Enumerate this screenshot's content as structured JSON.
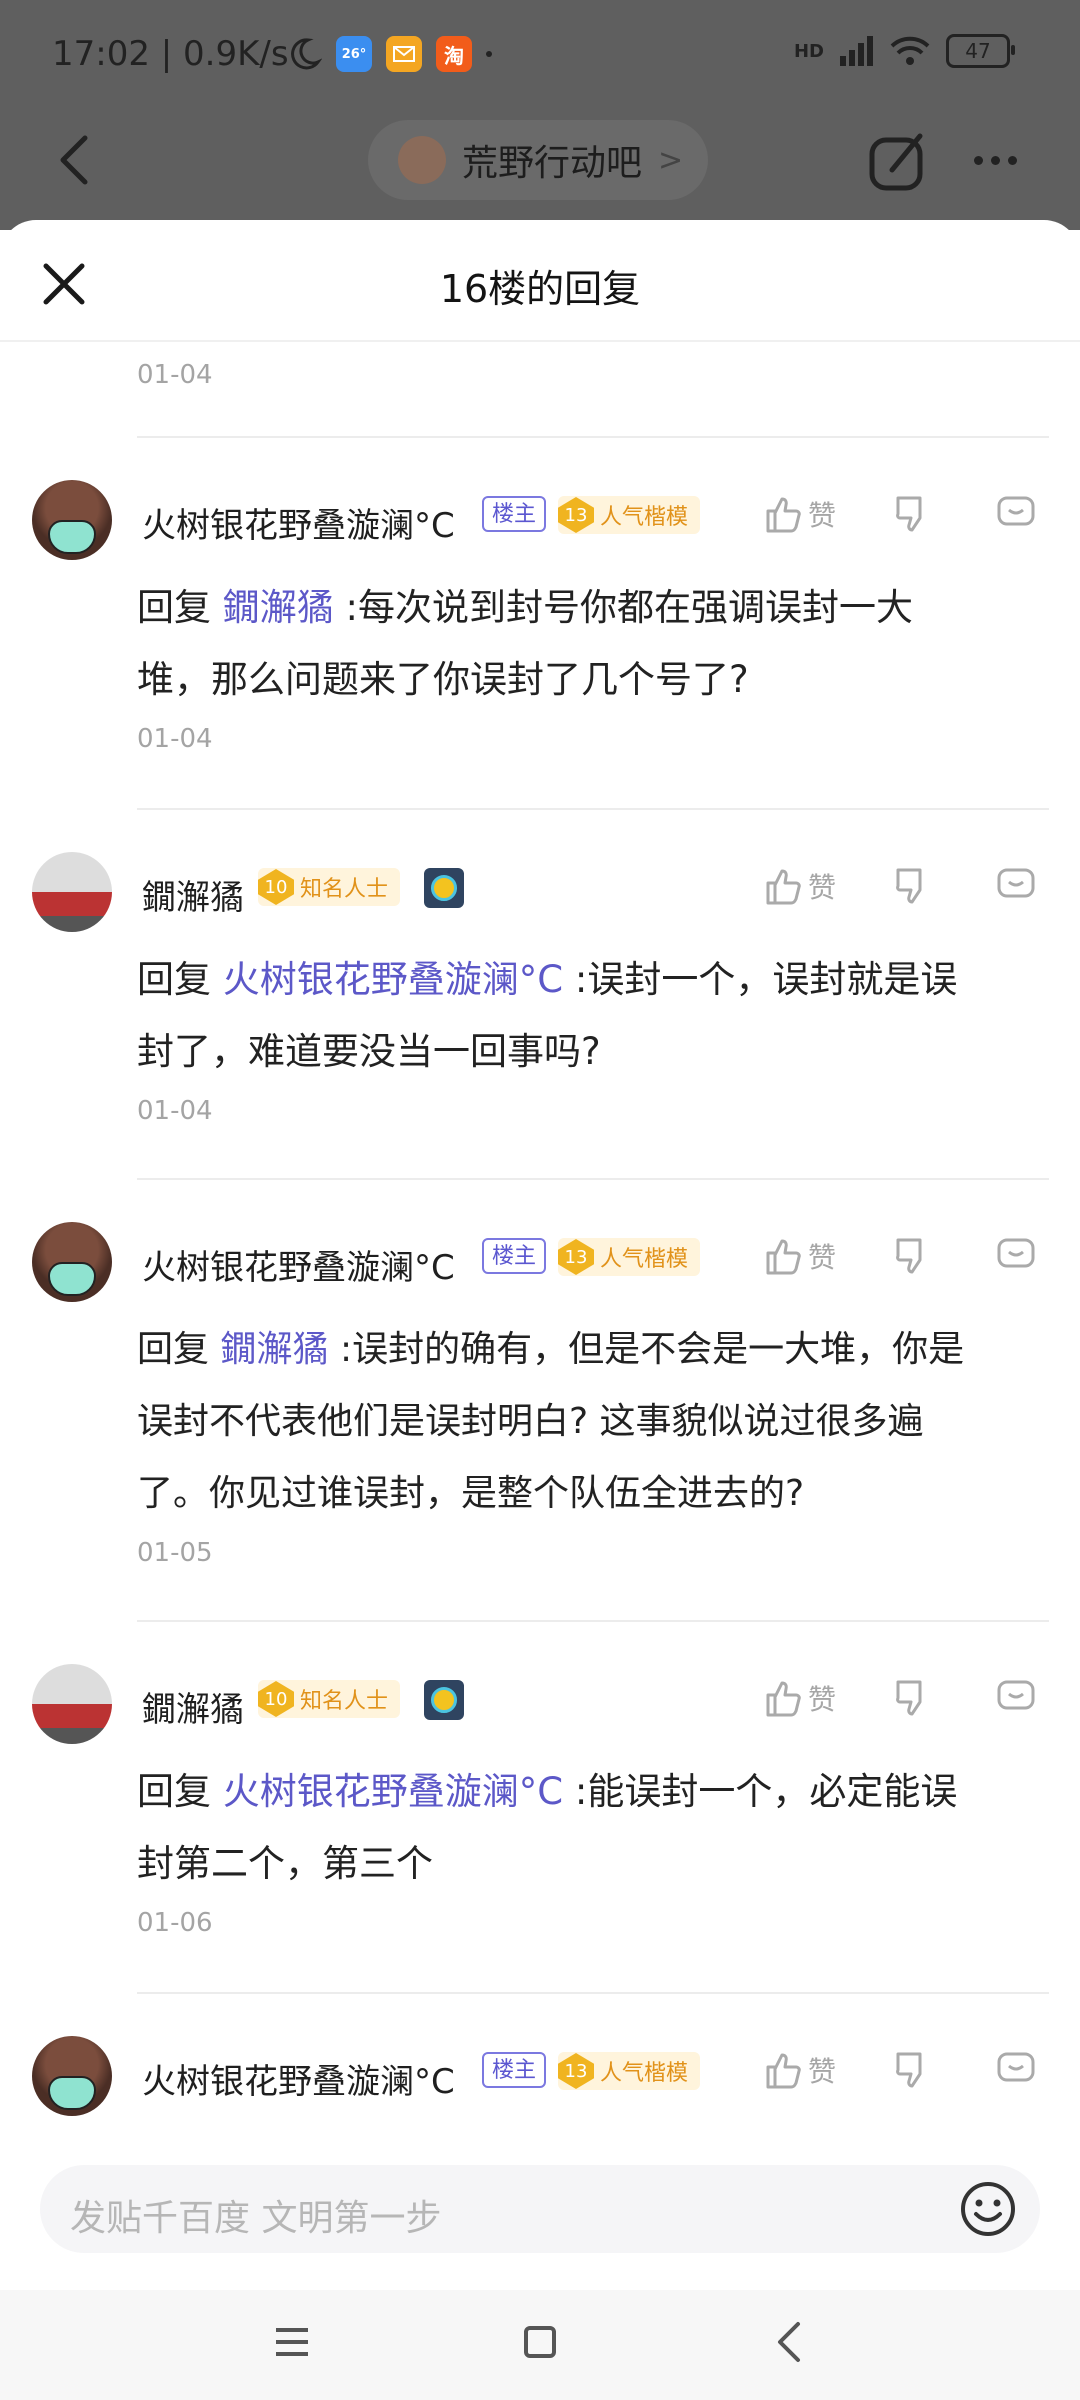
{
  "status_bar": {
    "time": "17:02 | 0.9K/s",
    "weather_badge": "26°",
    "taobao_badge": "淘",
    "network": "HD",
    "battery": "47"
  },
  "top_nav": {
    "forum_name": "荒野行动吧",
    "chevron": ">"
  },
  "sheet": {
    "title": "16楼的回复",
    "first_time": "01-04"
  },
  "actions": {
    "like_label": "赞"
  },
  "replies": [
    {
      "user": "火树银花野叠漩澜°C",
      "owner_tag": "楼主",
      "level": "13",
      "level_title": "人气楷模",
      "reply_prefix": "回复",
      "mention": "鐗澥獝",
      "text_line1": ":每次说到封号你都在强调误封一大",
      "text_line2": "堆，那么问题来了你误封了几个号了?",
      "time": "01-04"
    },
    {
      "user": "鐗澥獝",
      "level": "10",
      "level_title": "知名人士",
      "reply_prefix": "回复",
      "mention": "火树银花野叠漩澜°C",
      "text_line1": ":误封一个，误封就是误",
      "text_line2": "封了，难道要没当一回事吗?",
      "time": "01-04"
    },
    {
      "user": "火树银花野叠漩澜°C",
      "owner_tag": "楼主",
      "level": "13",
      "level_title": "人气楷模",
      "reply_prefix": "回复",
      "mention": "鐗澥獝",
      "text_line1": ":误封的确有，但是不会是一大堆，你是",
      "text_line2": "误封不代表他们是误封明白? 这事貌似说过很多遍",
      "text_line3": "了。你见过谁误封，是整个队伍全进去的?",
      "time": "01-05"
    },
    {
      "user": "鐗澥獝",
      "level": "10",
      "level_title": "知名人士",
      "reply_prefix": "回复",
      "mention": "火树银花野叠漩澜°C",
      "text_line1": ":能误封一个，必定能误",
      "text_line2": "封第二个，第三个",
      "time": "01-06"
    },
    {
      "user": "火树银花野叠漩澜°C",
      "owner_tag": "楼主",
      "level": "13",
      "level_title": "人气楷模"
    }
  ],
  "input": {
    "placeholder": "发贴千百度 文明第一步"
  },
  "colors": {
    "mention": "#5c58c8",
    "owner_tag": "#5b57d0",
    "level_gold": "#e1921a"
  }
}
